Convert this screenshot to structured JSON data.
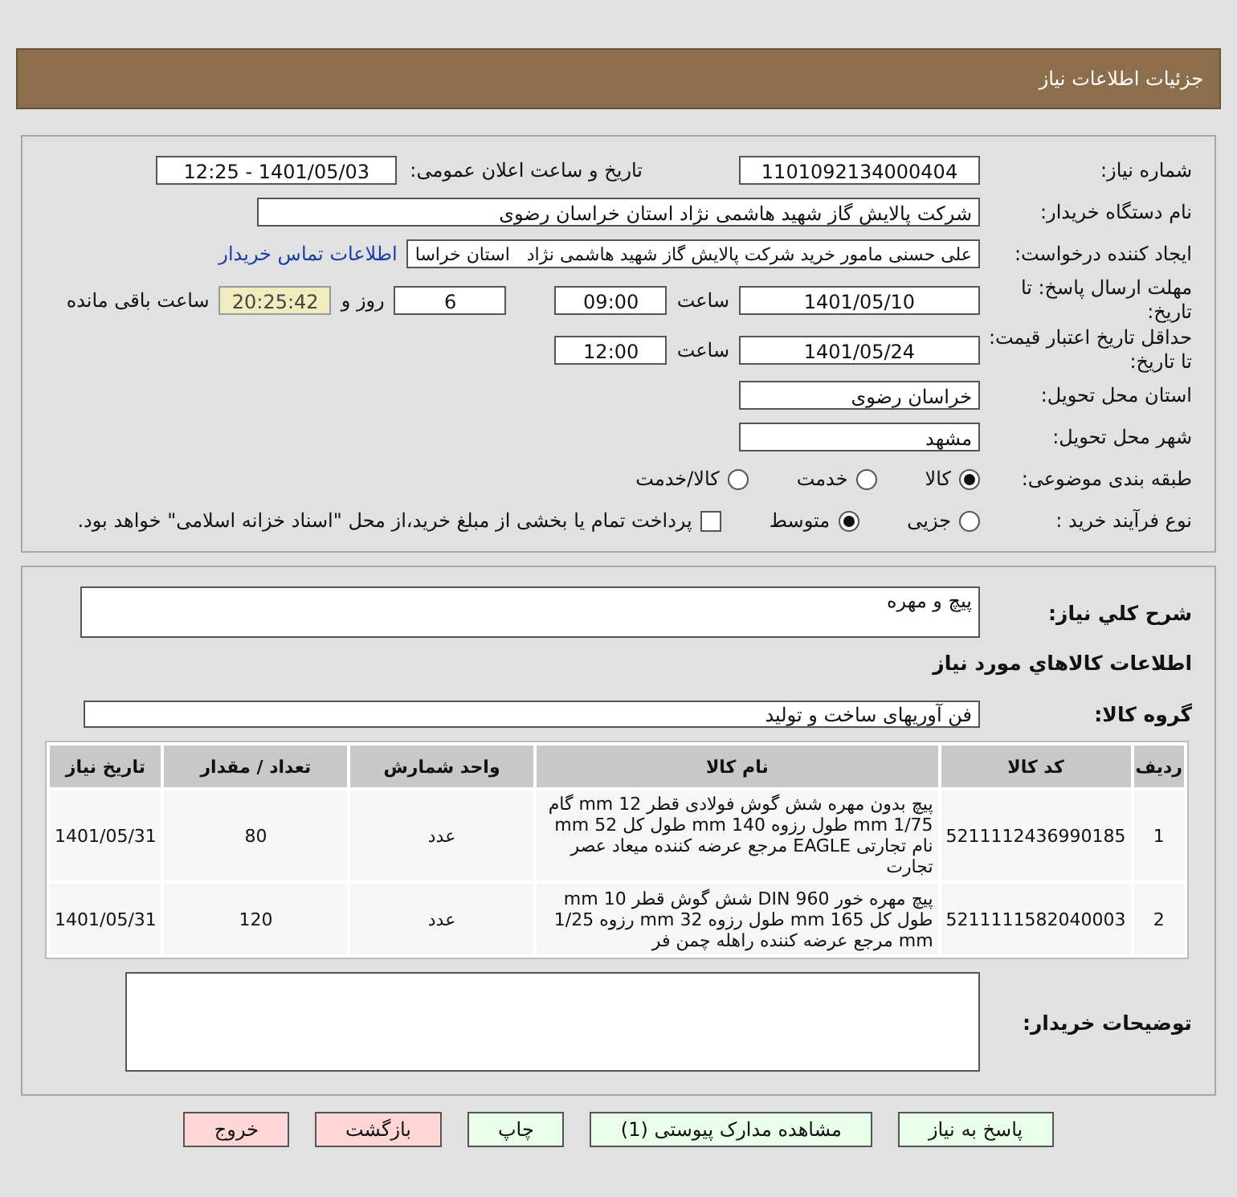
{
  "header": {
    "title": "جزئیات اطلاعات نیاز"
  },
  "need_number": {
    "label": "شماره نیاز:",
    "value": "1101092134000404"
  },
  "announce": {
    "label": "تاریخ و ساعت اعلان عمومی:",
    "value": "1401/05/03 - 12:25"
  },
  "buyer_org": {
    "label": "نام دستگاه خریدار:",
    "value": "شرکت پالایش گاز شهید هاشمی نژاد   استان خراسان رضوی"
  },
  "requester": {
    "label": "ایجاد کننده درخواست:",
    "value": "علی حسنی مامور خرید شرکت پالایش گاز شهید هاشمی نژاد   استان خراسا",
    "link": "اطلاعات تماس خریدار"
  },
  "deadline": {
    "label": "مهلت ارسال پاسخ: تا تاریخ:",
    "date": "1401/05/10",
    "time_label": "ساعت",
    "time": "09:00",
    "days": "6",
    "days_label": "روز و",
    "remaining": "20:25:42",
    "remaining_label": "ساعت باقی مانده"
  },
  "validity": {
    "label": "حداقل تاریخ اعتبار قیمت: تا تاریخ:",
    "date": "1401/05/24",
    "time_label": "ساعت",
    "time": "12:00"
  },
  "province": {
    "label": "استان محل تحویل:",
    "value": "خراسان رضوی"
  },
  "city": {
    "label": "شهر محل تحویل:",
    "value": "مشهد"
  },
  "category": {
    "label": "طبقه بندی موضوعی:",
    "options": [
      {
        "label": "کالا",
        "selected": true
      },
      {
        "label": "خدمت",
        "selected": false
      },
      {
        "label": "کالا/خدمت",
        "selected": false
      }
    ]
  },
  "process": {
    "label": "نوع فرآیند خرید :",
    "options": [
      {
        "label": "جزیی",
        "selected": false
      },
      {
        "label": "متوسط",
        "selected": true
      }
    ],
    "payment": {
      "label": "پرداخت تمام یا بخشی از مبلغ خرید،از محل \"اسناد خزانه اسلامی\" خواهد بود.",
      "checked": false
    }
  },
  "description": {
    "label": "شرح کلي نياز:",
    "value": "پیچ و مهره"
  },
  "goods_title": "اطلاعات کالاهاي مورد نياز",
  "group": {
    "label": "گروه کالا:",
    "value": "فن آوریهای ساخت و تولید"
  },
  "table": {
    "columns": [
      "ردیف",
      "کد کالا",
      "نام کالا",
      "واحد شمارش",
      "تعداد / مقدار",
      "تاریخ نیاز"
    ],
    "rows": [
      [
        "1",
        "5211112436990185",
        "پیچ بدون مهره شش گوش فولادی قطر 12 mm گام 1/75 mm طول رزوه 140 mm طول کل 52 mm نام تجارتی EAGLE مرجع عرضه کننده میعاد عصر تجارت",
        "عدد",
        "80",
        "1401/05/31"
      ],
      [
        "2",
        "5211111582040003",
        "پیچ مهره خور DIN 960 شش گوش قطر 10 mm طول کل 165 mm طول رزوه 32 mm رزوه 1/25 mm مرجع عرضه کننده راهله چمن فر",
        "عدد",
        "120",
        "1401/05/31"
      ]
    ]
  },
  "buyer_notes": {
    "label": "توضیحات خریدار:"
  },
  "buttons": [
    {
      "label": "پاسخ به نیاز",
      "kind": "action"
    },
    {
      "label": "مشاهده مدارک پیوستی (1)",
      "kind": "action"
    },
    {
      "label": "چاپ",
      "kind": "action"
    },
    {
      "label": "بازگشت",
      "kind": "nav"
    },
    {
      "label": "خروج",
      "kind": "nav"
    }
  ]
}
